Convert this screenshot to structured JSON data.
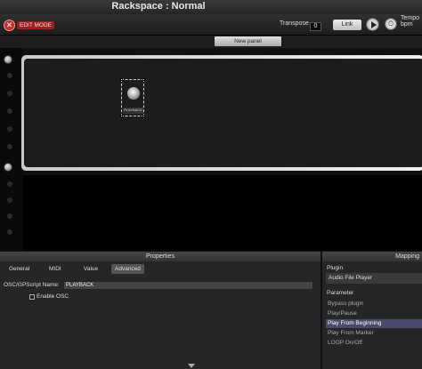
{
  "window": {
    "title": "Rackspace : Normal"
  },
  "toolbar": {
    "edit_mode_label": "EDIT MODE",
    "transpose_label": "Transpose",
    "transpose_value": "0",
    "link_label": "Link",
    "tempo_label": "Tempo",
    "tempo_unit": "bpm"
  },
  "rack": {
    "new_panel_label": "New panel"
  },
  "knob": {
    "label": "PLAYBACK"
  },
  "properties": {
    "title": "Properties",
    "tabs": [
      "General",
      "MIDI",
      "Value",
      "Advanced"
    ],
    "selected_tab": "Advanced",
    "osc_label": "OSC/GPScript Name:",
    "osc_value": "PLAYBACK",
    "enable_osc_label": "Enable OSC",
    "enable_osc_checked": false
  },
  "mapping": {
    "title": "Mapping",
    "plugin_header": "Plugin",
    "plugin_value": "Audio File Player",
    "parameter_header": "Parameter",
    "parameters": [
      "Bypass plugin",
      "Play/Pause",
      "Play From Beginning",
      "Play From Marker",
      "LOOP On/Off"
    ],
    "selected_parameter": "Play From Beginning"
  },
  "colors": {
    "edit_mode": "#c03030",
    "selection": "#4a4a6a"
  }
}
